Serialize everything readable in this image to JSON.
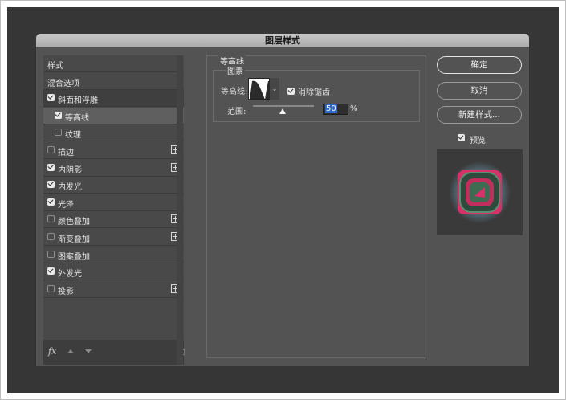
{
  "dialog": {
    "title": "图层样式"
  },
  "style_list": {
    "items": [
      {
        "label": "样式",
        "checkbox": null,
        "plus": false
      },
      {
        "label": "混合选项",
        "checkbox": null,
        "plus": false
      },
      {
        "label": "斜面和浮雕",
        "checkbox": true,
        "plus": false
      },
      {
        "label": "等高线",
        "checkbox": true,
        "plus": false,
        "selected": true,
        "indent": true
      },
      {
        "label": "纹理",
        "checkbox": false,
        "plus": false,
        "indent": true
      },
      {
        "label": "描边",
        "checkbox": false,
        "plus": true
      },
      {
        "label": "内阴影",
        "checkbox": true,
        "plus": true
      },
      {
        "label": "内发光",
        "checkbox": true,
        "plus": false
      },
      {
        "label": "光泽",
        "checkbox": true,
        "plus": false
      },
      {
        "label": "颜色叠加",
        "checkbox": false,
        "plus": true
      },
      {
        "label": "渐变叠加",
        "checkbox": false,
        "plus": true
      },
      {
        "label": "图案叠加",
        "checkbox": false,
        "plus": false
      },
      {
        "label": "外发光",
        "checkbox": true,
        "plus": false
      },
      {
        "label": "投影",
        "checkbox": false,
        "plus": true
      }
    ],
    "fx_label": "fx"
  },
  "contour_panel": {
    "section_title": "等高线",
    "group_title": "图素",
    "contour_label": "等高线:",
    "anti_alias_label": "消除锯齿",
    "anti_alias_checked": true,
    "range_label": "范围:",
    "range_value": "50",
    "range_unit": "%",
    "range_level_percent": 50
  },
  "buttons": {
    "ok": "确定",
    "cancel": "取消",
    "new_style": "新建样式..."
  },
  "preview": {
    "label": "预览",
    "checked": true
  },
  "colors": {
    "dialog_bg": "#535353",
    "preview_pink": "#d9306a",
    "preview_green": "#2f6a4c",
    "preview_glow": "#7db9d6"
  }
}
